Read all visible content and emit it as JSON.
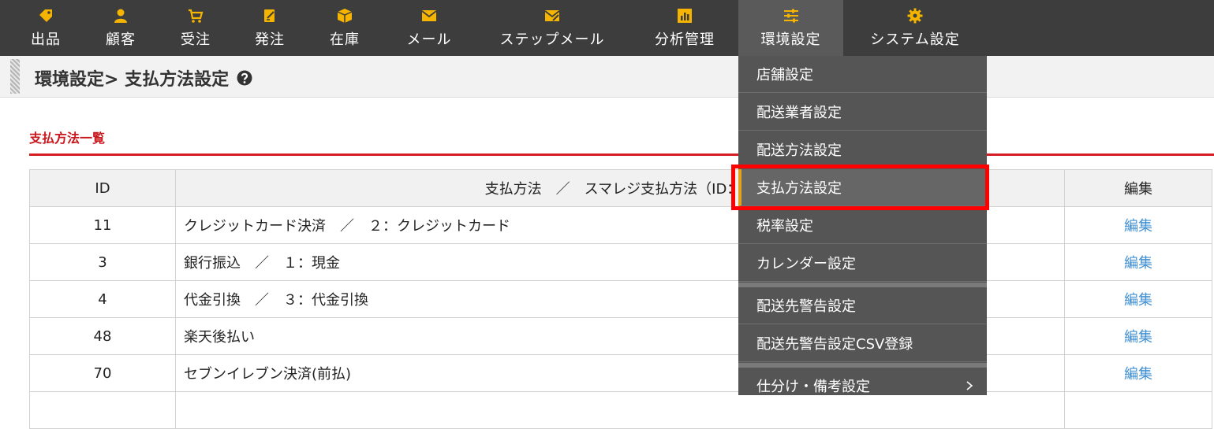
{
  "nav": {
    "items": [
      {
        "label": "出品",
        "icon": "tag-icon"
      },
      {
        "label": "顧客",
        "icon": "user-icon"
      },
      {
        "label": "受注",
        "icon": "cart-icon"
      },
      {
        "label": "発注",
        "icon": "order-form-icon"
      },
      {
        "label": "在庫",
        "icon": "box-icon"
      },
      {
        "label": "メール",
        "icon": "envelope-icon"
      },
      {
        "label": "ステップメール",
        "icon": "envelope-send-icon"
      },
      {
        "label": "分析管理",
        "icon": "bar-chart-icon"
      },
      {
        "label": "環境設定",
        "icon": "sliders-icon"
      },
      {
        "label": "システム設定",
        "icon": "gear-icon"
      }
    ],
    "active_label": "環境設定"
  },
  "header": {
    "title": "環境設定> 支払方法設定"
  },
  "section": {
    "title": "支払方法一覧"
  },
  "table": {
    "headers": {
      "id": "ID",
      "name": "支払方法　／　スマレジ支払方法（ID：支",
      "edit": "編集"
    },
    "rows": [
      {
        "id": "11",
        "name": "クレジットカード決済　／　２：クレジットカード",
        "edit": "編集"
      },
      {
        "id": "3",
        "name": "銀行振込　／　１：現金",
        "edit": "編集"
      },
      {
        "id": "4",
        "name": "代金引換　／　３：代金引換",
        "edit": "編集"
      },
      {
        "id": "48",
        "name": "楽天後払い",
        "edit": "編集"
      },
      {
        "id": "70",
        "name": "セブンイレブン決済(前払)",
        "edit": "編集"
      }
    ]
  },
  "dropdown": {
    "items": [
      {
        "label": "店舗設定"
      },
      {
        "label": "配送業者設定"
      },
      {
        "label": "配送方法設定"
      },
      {
        "label": "支払方法設定",
        "selected": true
      },
      {
        "label": "税率設定"
      },
      {
        "label": "カレンダー設定"
      },
      {
        "label": "配送先警告設定"
      },
      {
        "label": "配送先警告設定CSV登録"
      },
      {
        "label": "仕分け・備考設定"
      }
    ]
  },
  "colors": {
    "nav_bg": "#3d3d3d",
    "accent_red": "#d51f25",
    "icon_yellow": "#f4b400",
    "link_blue": "#3f8fd2",
    "selected_marker": "#e4a21b"
  }
}
